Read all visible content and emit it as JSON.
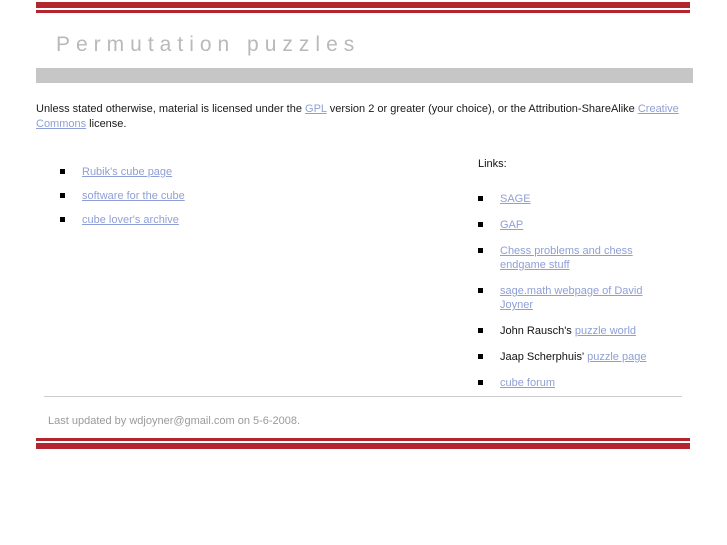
{
  "page": {
    "title": "Permutation puzzles",
    "accent_color": "#b3262f",
    "title_color": "#b9b9b9",
    "band_color": "#c6c6c6",
    "link_color": "#8f9fd6"
  },
  "license": {
    "text_before_gpl": "Unless stated otherwise, material is licensed under the ",
    "gpl_link": "GPL",
    "text_middle": " version 2 or greater (your choice), or the Attribution-ShareAlike ",
    "cc_link": "Creative Commons",
    "text_after": " license."
  },
  "left_column": {
    "items": [
      {
        "label": "Rubik's cube page",
        "is_link": true
      },
      {
        "label": "software for the cube",
        "is_link": true
      },
      {
        "label": "cube lover's archive",
        "is_link": true
      }
    ]
  },
  "right_column": {
    "heading": "Links:",
    "items": [
      {
        "prefix": "",
        "label": "SAGE",
        "is_link": true
      },
      {
        "prefix": "",
        "label": "GAP",
        "is_link": true
      },
      {
        "prefix": "",
        "label": "Chess problems and chess endgame stuff",
        "is_link": true
      },
      {
        "prefix": "",
        "label": "sage.math webpage of David Joyner",
        "is_link": true
      },
      {
        "prefix": "John Rausch's ",
        "label": "puzzle world",
        "is_link": true
      },
      {
        "prefix": "Jaap Scherphuis' ",
        "label": "puzzle page",
        "is_link": true
      },
      {
        "prefix": "",
        "label": "cube forum",
        "is_link": true
      }
    ]
  },
  "footer": {
    "text": "Last updated by wdjoyner@gmail.com on 5-6-2008."
  }
}
